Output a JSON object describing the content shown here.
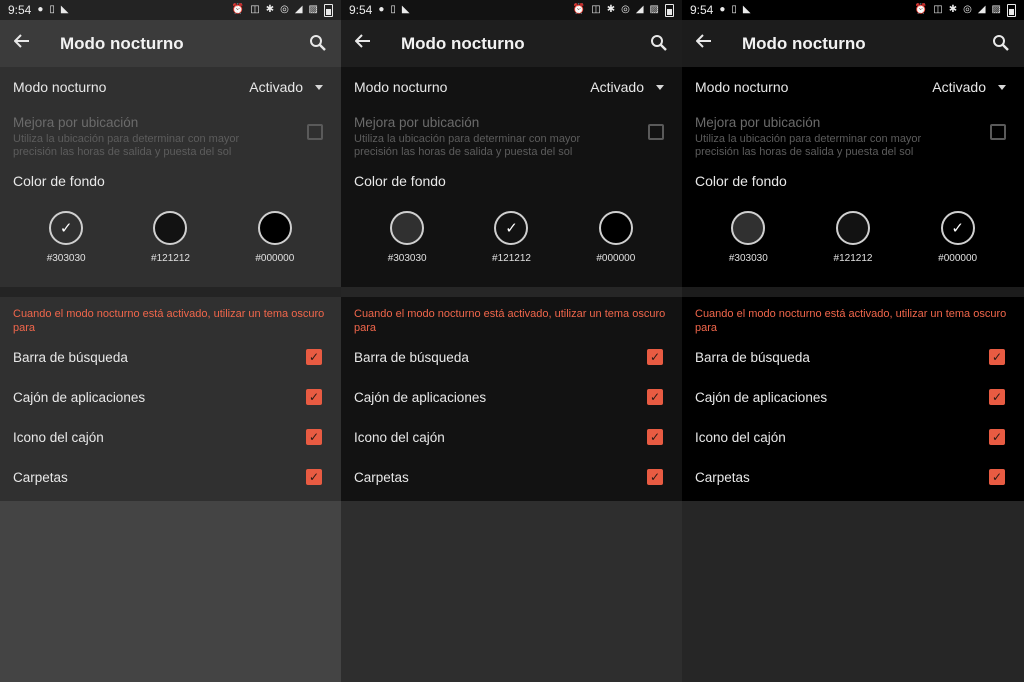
{
  "status_bar": {
    "time": "9:54"
  },
  "toolbar": {
    "title": "Modo nocturno"
  },
  "settings": {
    "mode_label": "Modo nocturno",
    "mode_value": "Activado",
    "location_title": "Mejora por ubicación",
    "location_desc": "Utiliza la ubicación para determinar con mayor precisión las horas de salida y puesta del sol",
    "bg_color_label": "Color de fondo",
    "swatches": [
      {
        "label": "#303030",
        "color": "#303030"
      },
      {
        "label": "#121212",
        "color": "#121212"
      },
      {
        "label": "#000000",
        "color": "#000000"
      }
    ],
    "note": "Cuando el modo nocturno está activado, utilizar un tema oscuro para",
    "options": [
      {
        "label": "Barra de búsqueda",
        "checked": true
      },
      {
        "label": "Cajón de aplicaciones",
        "checked": true
      },
      {
        "label": "Icono del cajón",
        "checked": true
      },
      {
        "label": "Carpetas",
        "checked": true
      }
    ]
  },
  "screens": [
    {
      "selected_swatch": 0
    },
    {
      "selected_swatch": 1
    },
    {
      "selected_swatch": 2
    }
  ],
  "colors": {
    "accent": "#E85B42",
    "note_text": "#F0664B"
  }
}
